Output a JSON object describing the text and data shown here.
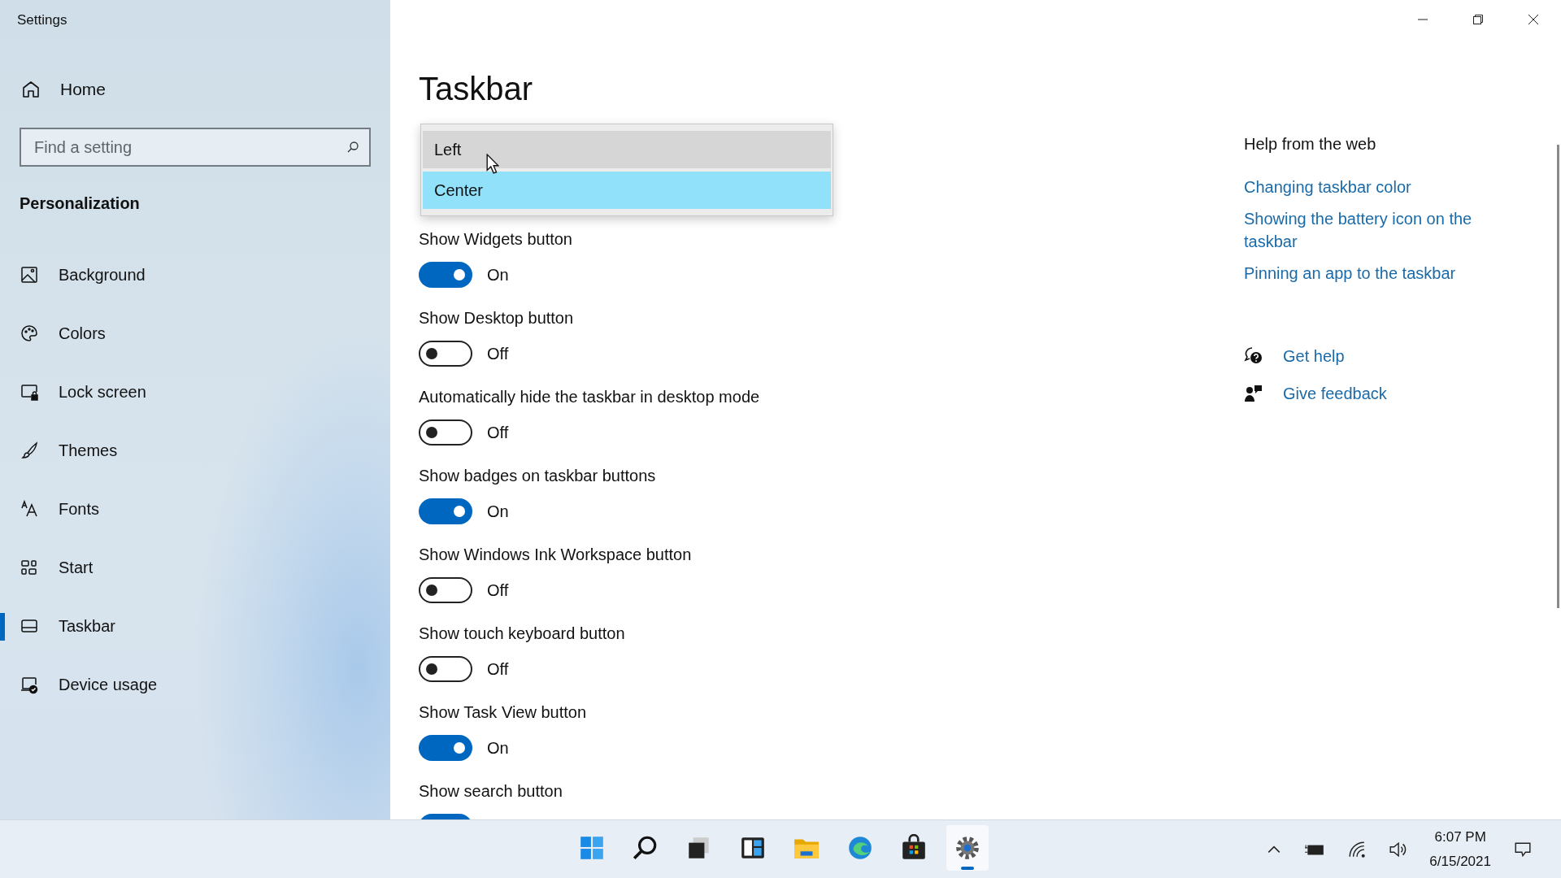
{
  "window": {
    "title": "Settings"
  },
  "sidebar": {
    "home": {
      "label": "Home"
    },
    "search": {
      "placeholder": "Find a setting"
    },
    "section": "Personalization",
    "items": [
      {
        "label": "Background",
        "selected": false
      },
      {
        "label": "Colors",
        "selected": false
      },
      {
        "label": "Lock screen",
        "selected": false
      },
      {
        "label": "Themes",
        "selected": false
      },
      {
        "label": "Fonts",
        "selected": false
      },
      {
        "label": "Start",
        "selected": false
      },
      {
        "label": "Taskbar",
        "selected": true
      },
      {
        "label": "Device usage",
        "selected": false
      }
    ]
  },
  "main": {
    "title": "Taskbar",
    "dropdown": {
      "options": [
        {
          "label": "Left",
          "selected": false,
          "hovered": true
        },
        {
          "label": "Center",
          "selected": true,
          "hovered": false
        }
      ]
    },
    "settings": [
      {
        "label": "Show Widgets button",
        "on": true,
        "value": "On"
      },
      {
        "label": "Show Desktop button",
        "on": false,
        "value": "Off"
      },
      {
        "label": "Automatically hide the taskbar in desktop mode",
        "on": false,
        "value": "Off"
      },
      {
        "label": "Show badges on taskbar buttons",
        "on": true,
        "value": "On"
      },
      {
        "label": "Show Windows Ink Workspace button",
        "on": false,
        "value": "Off"
      },
      {
        "label": "Show touch keyboard button",
        "on": false,
        "value": "Off"
      },
      {
        "label": "Show Task View button",
        "on": true,
        "value": "On"
      },
      {
        "label": "Show search button",
        "on": true
      }
    ]
  },
  "help": {
    "heading": "Help from the web",
    "links": [
      "Changing taskbar color",
      "Showing the battery icon on the taskbar",
      "Pinning an app to the taskbar"
    ],
    "actions": [
      {
        "label": "Get help"
      },
      {
        "label": "Give feedback"
      }
    ]
  },
  "taskbar": {
    "apps": [
      {
        "active": false
      },
      {
        "active": false
      },
      {
        "active": false
      },
      {
        "active": false
      },
      {
        "active": false
      },
      {
        "active": false
      },
      {
        "active": false
      },
      {
        "active": true
      }
    ],
    "time": "6:07 PM",
    "date": "6/15/2021"
  }
}
